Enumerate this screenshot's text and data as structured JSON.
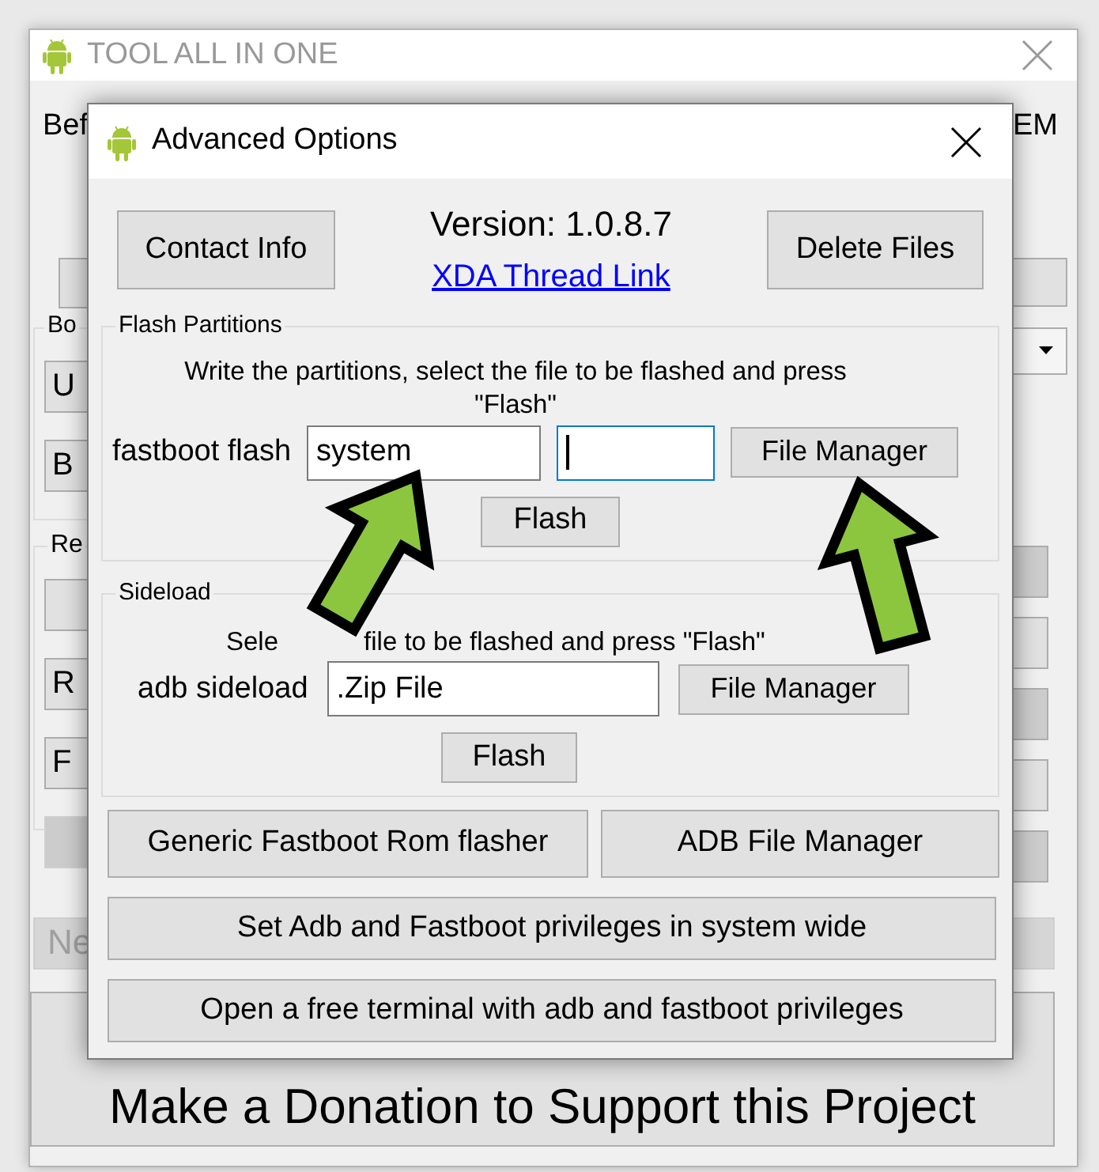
{
  "main_window": {
    "title": "TOOL ALL IN ONE",
    "header_left": "Bef",
    "header_right": "EM",
    "boot_group": {
      "legend": "Bo",
      "buttons": [
        "U",
        "B"
      ]
    },
    "recovery_group": {
      "legend": "Re",
      "buttons": [
        "R",
        "F"
      ]
    },
    "disabled_button": "Ne",
    "donation_button": "Make a Donation to Support this Project"
  },
  "dialog": {
    "title": "Advanced Options",
    "contact_button": "Contact Info",
    "version": "Version: 1.0.8.7",
    "thread_link": "XDA Thread Link",
    "delete_button": "Delete Files",
    "flash_partitions": {
      "legend": "Flash Partitions",
      "instruction": "Write the partitions, select the file to be flashed and press \"Flash\"",
      "label": "fastboot flash",
      "fields": [
        {
          "value": "system",
          "focused": false
        },
        {
          "focused": true
        }
      ],
      "file_manager_button": "File Manager",
      "flash_button": "Flash"
    },
    "sideload": {
      "legend": "Sideload",
      "instruction_parts": [
        "Sele",
        "file to be flashed and press \"Flash\""
      ],
      "label": "adb sideload",
      "field": {
        "value": ".Zip File",
        "focused": false
      },
      "file_manager_button": "File Manager",
      "flash_button": "Flash"
    },
    "row_buttons": [
      "Generic Fastboot Rom flasher",
      "ADB File Manager"
    ],
    "wide_buttons": [
      "Set Adb and Fastboot privileges in system wide",
      "Open a free terminal with adb and fastboot privileges"
    ]
  }
}
